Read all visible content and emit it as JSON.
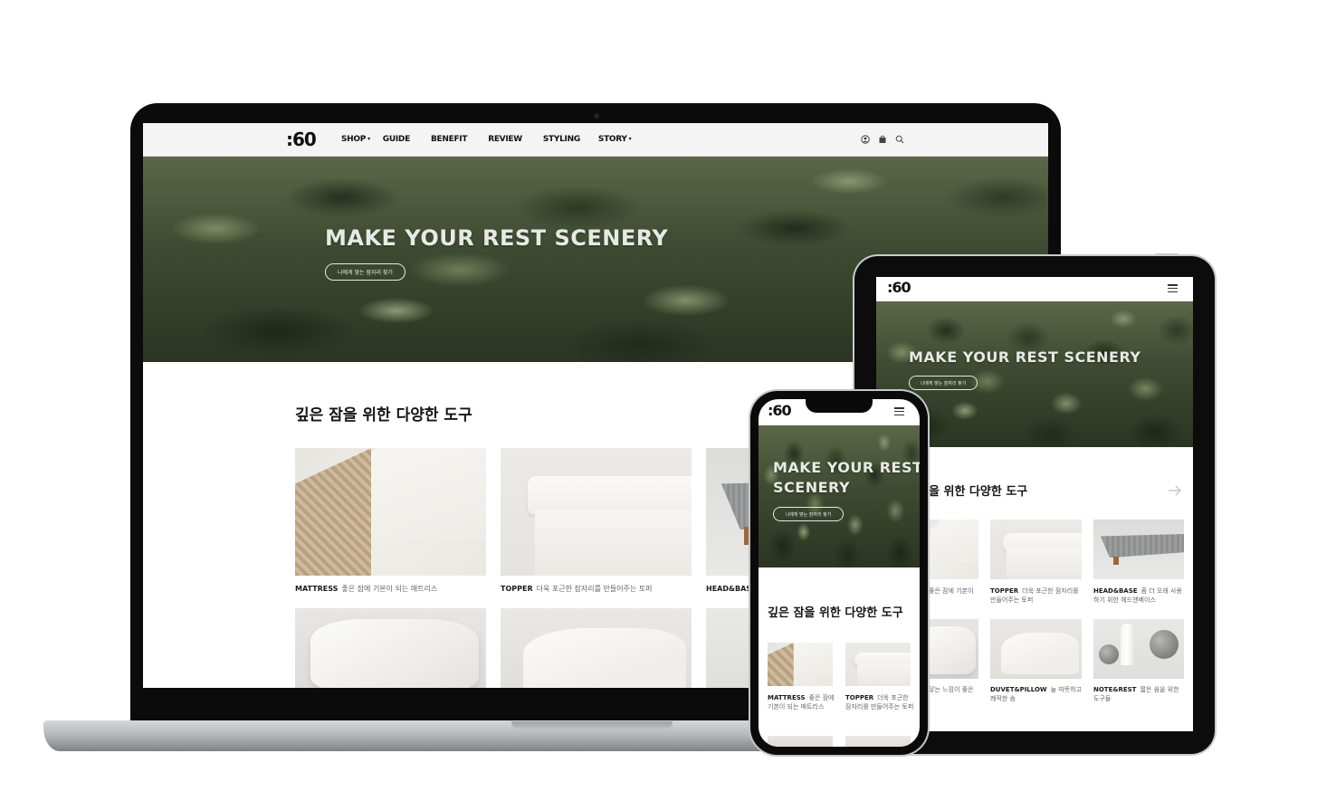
{
  "brand": {
    "logo": ":60"
  },
  "nav": {
    "items": [
      {
        "label": "SHOP",
        "caret": "▾"
      },
      {
        "label": "GUIDE"
      },
      {
        "label": "BENEFIT"
      },
      {
        "label": "REVIEW"
      },
      {
        "label": "STYLING"
      },
      {
        "label": "STORY",
        "caret": "▾"
      }
    ],
    "icons": [
      "user-icon",
      "bag-icon",
      "search-icon"
    ]
  },
  "hero": {
    "title": "MAKE YOUR REST SCENERY",
    "title_line1": "MAKE YOUR REST",
    "title_line2": "SCENERY",
    "button": "나에게 맞는 잠자리 찾기"
  },
  "section": {
    "title": "깊은 잠을 위한 다양한 도구"
  },
  "products": [
    {
      "name": "MATTRESS",
      "desc": "좋은 잠에 기본이 되는 매트리스"
    },
    {
      "name": "TOPPER",
      "desc": "더욱 포근한 잠자리를 만들어주는 토퍼"
    },
    {
      "name": "HEAD&BASE",
      "desc": "좀 더 오래 사용하기 위한 헤드앤베이스"
    },
    {
      "name": "",
      "desc": "닿는 느낌이 좋은"
    },
    {
      "name": "DUVET&PILLOW",
      "desc": "늘 따뜻하고 쾌적한 솜"
    },
    {
      "name": "NOTE&REST",
      "desc": "짧은 쉼을 위한 도구들"
    }
  ],
  "tablet_partial": {
    "section_title": "을 위한 다양한 도구",
    "mattress_desc": "좋은 잠에 기본이"
  },
  "colors": {
    "ink": "#111111",
    "muted": "#666666",
    "nav_bg": "#f4f4f4",
    "forest": "#3f4b33"
  },
  "icons": {
    "next": "arrow-right-icon",
    "menu": "hamburger-icon"
  }
}
